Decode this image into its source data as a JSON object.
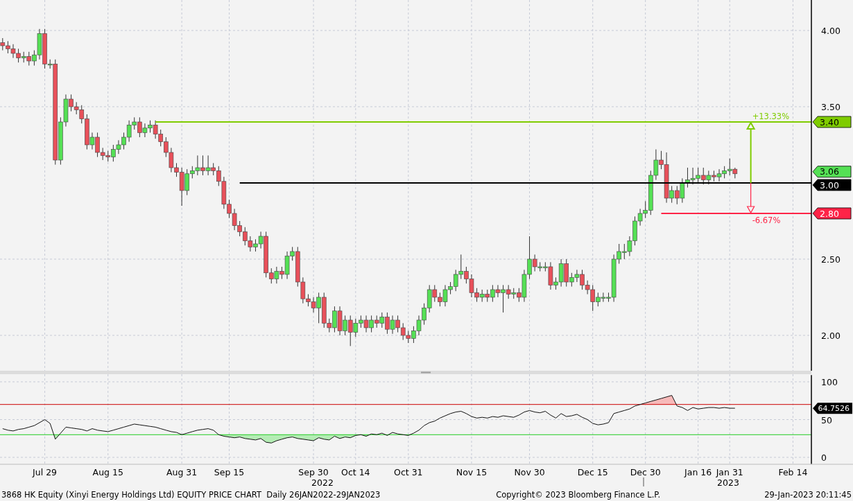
{
  "price_chart": {
    "chart_data": {
      "type": "candlestick",
      "grid": true,
      "ylim": [
        1.768,
        4.2
      ],
      "yticks": [
        {
          "value": 2,
          "label": "2.00"
        },
        {
          "value": 2.5,
          "label": "2.50"
        },
        {
          "value": 3.5,
          "label": "3.50"
        },
        {
          "value": 4,
          "label": "4.00"
        }
      ],
      "categories": [
        null,
        null,
        null,
        null,
        null,
        null,
        null,
        null,
        null,
        null,
        null,
        null,
        null,
        null,
        null,
        null,
        null,
        null,
        null,
        null,
        null,
        null,
        null,
        null,
        null,
        null,
        null,
        null,
        null,
        null,
        null,
        null,
        null,
        null,
        null,
        null,
        null,
        null,
        null,
        null,
        null,
        null,
        null,
        null,
        null,
        null,
        null,
        null,
        null,
        null,
        null,
        null,
        null,
        null,
        null,
        null,
        null,
        null,
        null,
        null,
        null,
        null,
        null,
        null,
        null,
        null,
        null,
        null,
        null,
        null,
        null,
        null,
        null,
        null,
        null,
        null,
        null,
        null,
        null,
        null,
        null,
        null,
        null,
        null,
        null,
        null,
        null,
        null,
        null,
        null,
        null,
        null,
        null,
        null,
        null,
        null,
        null,
        null,
        null,
        null,
        null,
        null,
        null,
        null,
        null,
        null,
        null,
        null,
        null,
        null,
        null,
        null,
        null,
        null,
        null,
        null,
        null,
        null,
        null,
        null,
        null,
        null,
        null,
        null,
        null,
        null,
        null,
        null,
        null,
        null,
        null,
        null,
        null,
        null,
        null,
        null,
        null,
        null,
        null,
        null,
        null,
        null,
        null,
        null,
        null,
        null,
        null,
        null,
        null,
        null,
        null,
        null,
        null,
        null
      ],
      "ohlc": [
        [
          3.92,
          3.95,
          3.87,
          3.9
        ],
        [
          3.9,
          3.93,
          3.85,
          3.88
        ],
        [
          3.88,
          3.91,
          3.82,
          3.85
        ],
        [
          3.85,
          3.88,
          3.79,
          3.82
        ],
        [
          3.82,
          3.86,
          3.79,
          3.83
        ],
        [
          3.83,
          3.86,
          3.77,
          3.8
        ],
        [
          3.8,
          3.87,
          3.77,
          3.84
        ],
        [
          3.84,
          4.01,
          3.81,
          3.98
        ],
        [
          3.98,
          4.01,
          3.75,
          3.78
        ],
        [
          3.78,
          3.81,
          3.75,
          3.78
        ],
        [
          3.78,
          3.81,
          3.12,
          3.15
        ],
        [
          3.15,
          3.43,
          3.12,
          3.4
        ],
        [
          3.4,
          3.58,
          3.37,
          3.55
        ],
        [
          3.55,
          3.58,
          3.47,
          3.5
        ],
        [
          3.5,
          3.53,
          3.45,
          3.48
        ],
        [
          3.48,
          3.51,
          3.39,
          3.42
        ],
        [
          3.42,
          3.45,
          3.22,
          3.25
        ],
        [
          3.25,
          3.33,
          3.22,
          3.3
        ],
        [
          3.3,
          3.33,
          3.17,
          3.2
        ],
        [
          3.2,
          3.23,
          3.15,
          3.18
        ],
        [
          3.18,
          3.21,
          3.14,
          3.17
        ],
        [
          3.17,
          3.25,
          3.14,
          3.22
        ],
        [
          3.22,
          3.28,
          3.19,
          3.25
        ],
        [
          3.25,
          3.33,
          3.22,
          3.3
        ],
        [
          3.3,
          3.41,
          3.27,
          3.38
        ],
        [
          3.38,
          3.43,
          3.35,
          3.4
        ],
        [
          3.4,
          3.43,
          3.3,
          3.33
        ],
        [
          3.33,
          3.39,
          3.3,
          3.36
        ],
        [
          3.36,
          3.41,
          3.33,
          3.38
        ],
        [
          3.38,
          3.41,
          3.29,
          3.32
        ],
        [
          3.32,
          3.35,
          3.24,
          3.27
        ],
        [
          3.27,
          3.3,
          3.17,
          3.2
        ],
        [
          3.2,
          3.23,
          3.07,
          3.1
        ],
        [
          3.1,
          3.13,
          3.04,
          3.07
        ],
        [
          3.07,
          3.1,
          2.85,
          2.95
        ],
        [
          2.95,
          3.09,
          2.92,
          3.06
        ],
        [
          3.06,
          3.11,
          3.03,
          3.08
        ],
        [
          3.08,
          3.18,
          3.05,
          3.1
        ],
        [
          3.1,
          3.18,
          3.05,
          3.08
        ],
        [
          3.08,
          3.18,
          3.05,
          3.1
        ],
        [
          3.1,
          3.13,
          3.05,
          3.08
        ],
        [
          3.08,
          3.11,
          2.98,
          3.01
        ],
        [
          3.01,
          3.04,
          2.83,
          2.86
        ],
        [
          2.86,
          2.89,
          2.77,
          2.8
        ],
        [
          2.8,
          2.83,
          2.69,
          2.72
        ],
        [
          2.72,
          2.75,
          2.65,
          2.68
        ],
        [
          2.68,
          2.71,
          2.59,
          2.62
        ],
        [
          2.62,
          2.65,
          2.55,
          2.58
        ],
        [
          2.58,
          2.63,
          2.55,
          2.6
        ],
        [
          2.6,
          2.68,
          2.57,
          2.65
        ],
        [
          2.65,
          2.68,
          2.38,
          2.41
        ],
        [
          2.41,
          2.44,
          2.34,
          2.37
        ],
        [
          2.37,
          2.45,
          2.34,
          2.42
        ],
        [
          2.42,
          2.45,
          2.37,
          2.4
        ],
        [
          2.4,
          2.55,
          2.37,
          2.52
        ],
        [
          2.52,
          2.58,
          2.49,
          2.55
        ],
        [
          2.55,
          2.58,
          2.32,
          2.35
        ],
        [
          2.35,
          2.38,
          2.21,
          2.24
        ],
        [
          2.24,
          2.27,
          2.19,
          2.22
        ],
        [
          2.22,
          2.25,
          2.15,
          2.18
        ],
        [
          2.18,
          2.28,
          2.08,
          2.25
        ],
        [
          2.25,
          2.28,
          2.05,
          2.08
        ],
        [
          2.08,
          2.11,
          2.02,
          2.05
        ],
        [
          2.05,
          2.19,
          2.02,
          2.16
        ],
        [
          2.16,
          2.19,
          2.0,
          2.03
        ],
        [
          2.03,
          2.13,
          2.0,
          2.1
        ],
        [
          2.1,
          2.13,
          1.93,
          2.02
        ],
        [
          2.02,
          2.11,
          1.99,
          2.08
        ],
        [
          2.08,
          2.13,
          2.05,
          2.1
        ],
        [
          2.1,
          2.13,
          2.02,
          2.05
        ],
        [
          2.05,
          2.13,
          2.02,
          2.1
        ],
        [
          2.1,
          2.13,
          2.05,
          2.08
        ],
        [
          2.08,
          2.15,
          2.05,
          2.12
        ],
        [
          2.12,
          2.15,
          2.01,
          2.04
        ],
        [
          2.04,
          2.13,
          2.01,
          2.1
        ],
        [
          2.1,
          2.13,
          2.02,
          2.05
        ],
        [
          2.05,
          2.08,
          1.97,
          2.0
        ],
        [
          2.0,
          2.03,
          1.95,
          1.98
        ],
        [
          1.98,
          2.06,
          1.95,
          2.03
        ],
        [
          2.03,
          2.13,
          2.0,
          2.1
        ],
        [
          2.1,
          2.21,
          2.07,
          2.18
        ],
        [
          2.18,
          2.33,
          2.15,
          2.3
        ],
        [
          2.3,
          2.33,
          2.22,
          2.25
        ],
        [
          2.25,
          2.28,
          2.19,
          2.22
        ],
        [
          2.22,
          2.33,
          2.19,
          2.3
        ],
        [
          2.3,
          2.35,
          2.27,
          2.32
        ],
        [
          2.32,
          2.43,
          2.29,
          2.4
        ],
        [
          2.4,
          2.53,
          2.37,
          2.42
        ],
        [
          2.42,
          2.45,
          2.34,
          2.37
        ],
        [
          2.37,
          2.4,
          2.25,
          2.28
        ],
        [
          2.28,
          2.31,
          2.22,
          2.25
        ],
        [
          2.25,
          2.3,
          2.22,
          2.27
        ],
        [
          2.27,
          2.3,
          2.22,
          2.25
        ],
        [
          2.25,
          2.33,
          2.22,
          2.3
        ],
        [
          2.3,
          2.33,
          2.25,
          2.28
        ],
        [
          2.28,
          2.33,
          2.15,
          2.3
        ],
        [
          2.3,
          2.33,
          2.24,
          2.27
        ],
        [
          2.27,
          2.31,
          2.24,
          2.28
        ],
        [
          2.28,
          2.31,
          2.22,
          2.25
        ],
        [
          2.25,
          2.43,
          2.22,
          2.4
        ],
        [
          2.4,
          2.65,
          2.37,
          2.5
        ],
        [
          2.5,
          2.53,
          2.42,
          2.45
        ],
        [
          2.45,
          2.48,
          2.42,
          2.45
        ],
        [
          2.45,
          2.48,
          2.42,
          2.45
        ],
        [
          2.45,
          2.48,
          2.3,
          2.33
        ],
        [
          2.33,
          2.38,
          2.3,
          2.35
        ],
        [
          2.35,
          2.5,
          2.32,
          2.47
        ],
        [
          2.47,
          2.5,
          2.32,
          2.35
        ],
        [
          2.35,
          2.41,
          2.32,
          2.38
        ],
        [
          2.38,
          2.43,
          2.35,
          2.4
        ],
        [
          2.4,
          2.43,
          2.3,
          2.33
        ],
        [
          2.33,
          2.36,
          2.27,
          2.3
        ],
        [
          2.3,
          2.33,
          2.16,
          2.22
        ],
        [
          2.22,
          2.28,
          2.19,
          2.25
        ],
        [
          2.25,
          2.28,
          2.22,
          2.25
        ],
        [
          2.25,
          2.28,
          2.22,
          2.25
        ],
        [
          2.25,
          2.53,
          2.22,
          2.5
        ],
        [
          2.5,
          2.6,
          2.47,
          2.55
        ],
        [
          2.55,
          2.6,
          2.5,
          2.55
        ],
        [
          2.55,
          2.65,
          2.52,
          2.62
        ],
        [
          2.62,
          2.78,
          2.59,
          2.75
        ],
        [
          2.75,
          2.83,
          2.72,
          2.8
        ],
        [
          2.8,
          2.88,
          2.77,
          2.82
        ],
        [
          2.82,
          3.08,
          2.79,
          3.05
        ],
        [
          3.05,
          3.22,
          3.02,
          3.15
        ],
        [
          3.15,
          3.21,
          3.09,
          3.12
        ],
        [
          3.12,
          3.2,
          2.87,
          2.9
        ],
        [
          2.9,
          2.98,
          2.87,
          2.95
        ],
        [
          2.95,
          2.98,
          2.86,
          2.9
        ],
        [
          2.9,
          3.03,
          2.87,
          3.0
        ],
        [
          3.0,
          3.1,
          2.97,
          3.02
        ],
        [
          3.02,
          3.1,
          2.99,
          3.03
        ],
        [
          3.03,
          3.1,
          3.0,
          3.05
        ],
        [
          3.05,
          3.1,
          2.99,
          3.02
        ],
        [
          3.02,
          3.08,
          2.99,
          3.05
        ],
        [
          3.05,
          3.08,
          3.01,
          3.04
        ],
        [
          3.04,
          3.09,
          3.01,
          3.06
        ],
        [
          3.06,
          3.11,
          3.03,
          3.08
        ],
        [
          3.08,
          3.16,
          3.05,
          3.09
        ],
        [
          3.09,
          3.1,
          3.03,
          3.06
        ],
        null,
        null,
        null,
        null,
        null,
        null,
        null,
        null,
        null,
        null,
        null,
        null,
        null,
        null
      ],
      "ref_lines": [
        {
          "axis": "y",
          "value": 3.4,
          "color": "#7fcc00",
          "label": "3.40"
        },
        {
          "axis": "y",
          "value": 3.0,
          "color": "#000000",
          "label": "3.00"
        },
        {
          "axis": "y",
          "value": 2.8,
          "color": "#ff2447",
          "label": "2.80"
        }
      ],
      "annotations": [
        "+13.33%",
        "-6.67%"
      ]
    },
    "last_price_tag": {
      "label": "3.06",
      "color": "#55e055"
    }
  },
  "rsi_chart": {
    "chart_data": {
      "type": "line",
      "grid": true,
      "ylim": [
        -9,
        109
      ],
      "yticks": [
        {
          "value": 0,
          "label": "0"
        },
        {
          "value": 50,
          "label": "50"
        },
        {
          "value": 100,
          "label": "100"
        }
      ],
      "categories": [
        null,
        null,
        null,
        null,
        null,
        null,
        null,
        null,
        "Jul 29",
        null,
        null,
        null,
        null,
        null,
        null,
        null,
        null,
        null,
        null,
        null,
        "Aug 15",
        null,
        null,
        null,
        null,
        null,
        null,
        null,
        null,
        null,
        null,
        null,
        null,
        null,
        "Aug 31",
        null,
        null,
        null,
        null,
        null,
        null,
        null,
        null,
        "Sep 15",
        null,
        null,
        null,
        null,
        null,
        null,
        null,
        null,
        null,
        null,
        null,
        null,
        null,
        null,
        null,
        "Sep 30",
        null,
        null,
        null,
        null,
        null,
        null,
        null,
        "Oct 14",
        null,
        null,
        null,
        null,
        null,
        null,
        null,
        null,
        null,
        "Oct 31",
        null,
        null,
        null,
        null,
        null,
        null,
        null,
        null,
        null,
        null,
        null,
        "Nov 15",
        null,
        null,
        null,
        null,
        null,
        null,
        null,
        null,
        null,
        null,
        "Nov 30",
        null,
        null,
        null,
        null,
        null,
        null,
        null,
        null,
        null,
        null,
        null,
        "Dec 15",
        null,
        null,
        null,
        null,
        null,
        null,
        null,
        null,
        null,
        "Dec 30",
        null,
        null,
        null,
        null,
        null,
        null,
        null,
        null,
        null,
        "Jan 16",
        null,
        null,
        null,
        null,
        null,
        "Jan 31",
        null,
        null,
        null,
        null,
        null,
        null,
        null,
        null,
        null,
        null,
        null,
        "Feb 14",
        null,
        null,
        null
      ],
      "series": [
        {
          "color": "#111111",
          "values": [
            38,
            36,
            35,
            37,
            38,
            40,
            42,
            46,
            50,
            45,
            24,
            32,
            40,
            39,
            38,
            37,
            35,
            38,
            36,
            35,
            34,
            36,
            38,
            40,
            42,
            44,
            43,
            42,
            41,
            40,
            38,
            36,
            34,
            33,
            30,
            32,
            34,
            36,
            37,
            38,
            36,
            30,
            28,
            27,
            26,
            27,
            25,
            24,
            23,
            25,
            20,
            19,
            22,
            24,
            26,
            27,
            25,
            24,
            23,
            22,
            26,
            24,
            23,
            28,
            25,
            27,
            26,
            29,
            30,
            28,
            31,
            30,
            32,
            29,
            33,
            31,
            30,
            29,
            32,
            36,
            42,
            46,
            48,
            52,
            55,
            58,
            60,
            61,
            58,
            54,
            52,
            53,
            52,
            54,
            53,
            55,
            54,
            53,
            56,
            60,
            62,
            60,
            59,
            61,
            56,
            52,
            58,
            54,
            55,
            57,
            53,
            50,
            45,
            43,
            44,
            46,
            58,
            60,
            62,
            64,
            68,
            70,
            72,
            74,
            76,
            78,
            80,
            82,
            68,
            66,
            62,
            66,
            64,
            65,
            66,
            66,
            65,
            66,
            65,
            65,
            null,
            null,
            null,
            null,
            null,
            null,
            null,
            null,
            null,
            null,
            null,
            null,
            null,
            null
          ]
        }
      ],
      "ref_lines": [
        {
          "axis": "y",
          "value": 70,
          "color": "#cc0000"
        },
        {
          "axis": "y",
          "value": 30,
          "color": "#22cc22"
        }
      ]
    },
    "last_value_tag": {
      "label": "64.7526",
      "color": "#000000"
    }
  },
  "year_labels": [
    "2022",
    "2023"
  ],
  "footer": {
    "description": "3868 HK Equity (Xinyi Energy Holdings Ltd) EQUITY PRICE CHART  Daily 26JAN2022-29JAN2023",
    "copyright": "Copyright© 2023 Bloomberg Finance L.P.",
    "timestamp": "29-Jan-2023 20:11:45"
  }
}
